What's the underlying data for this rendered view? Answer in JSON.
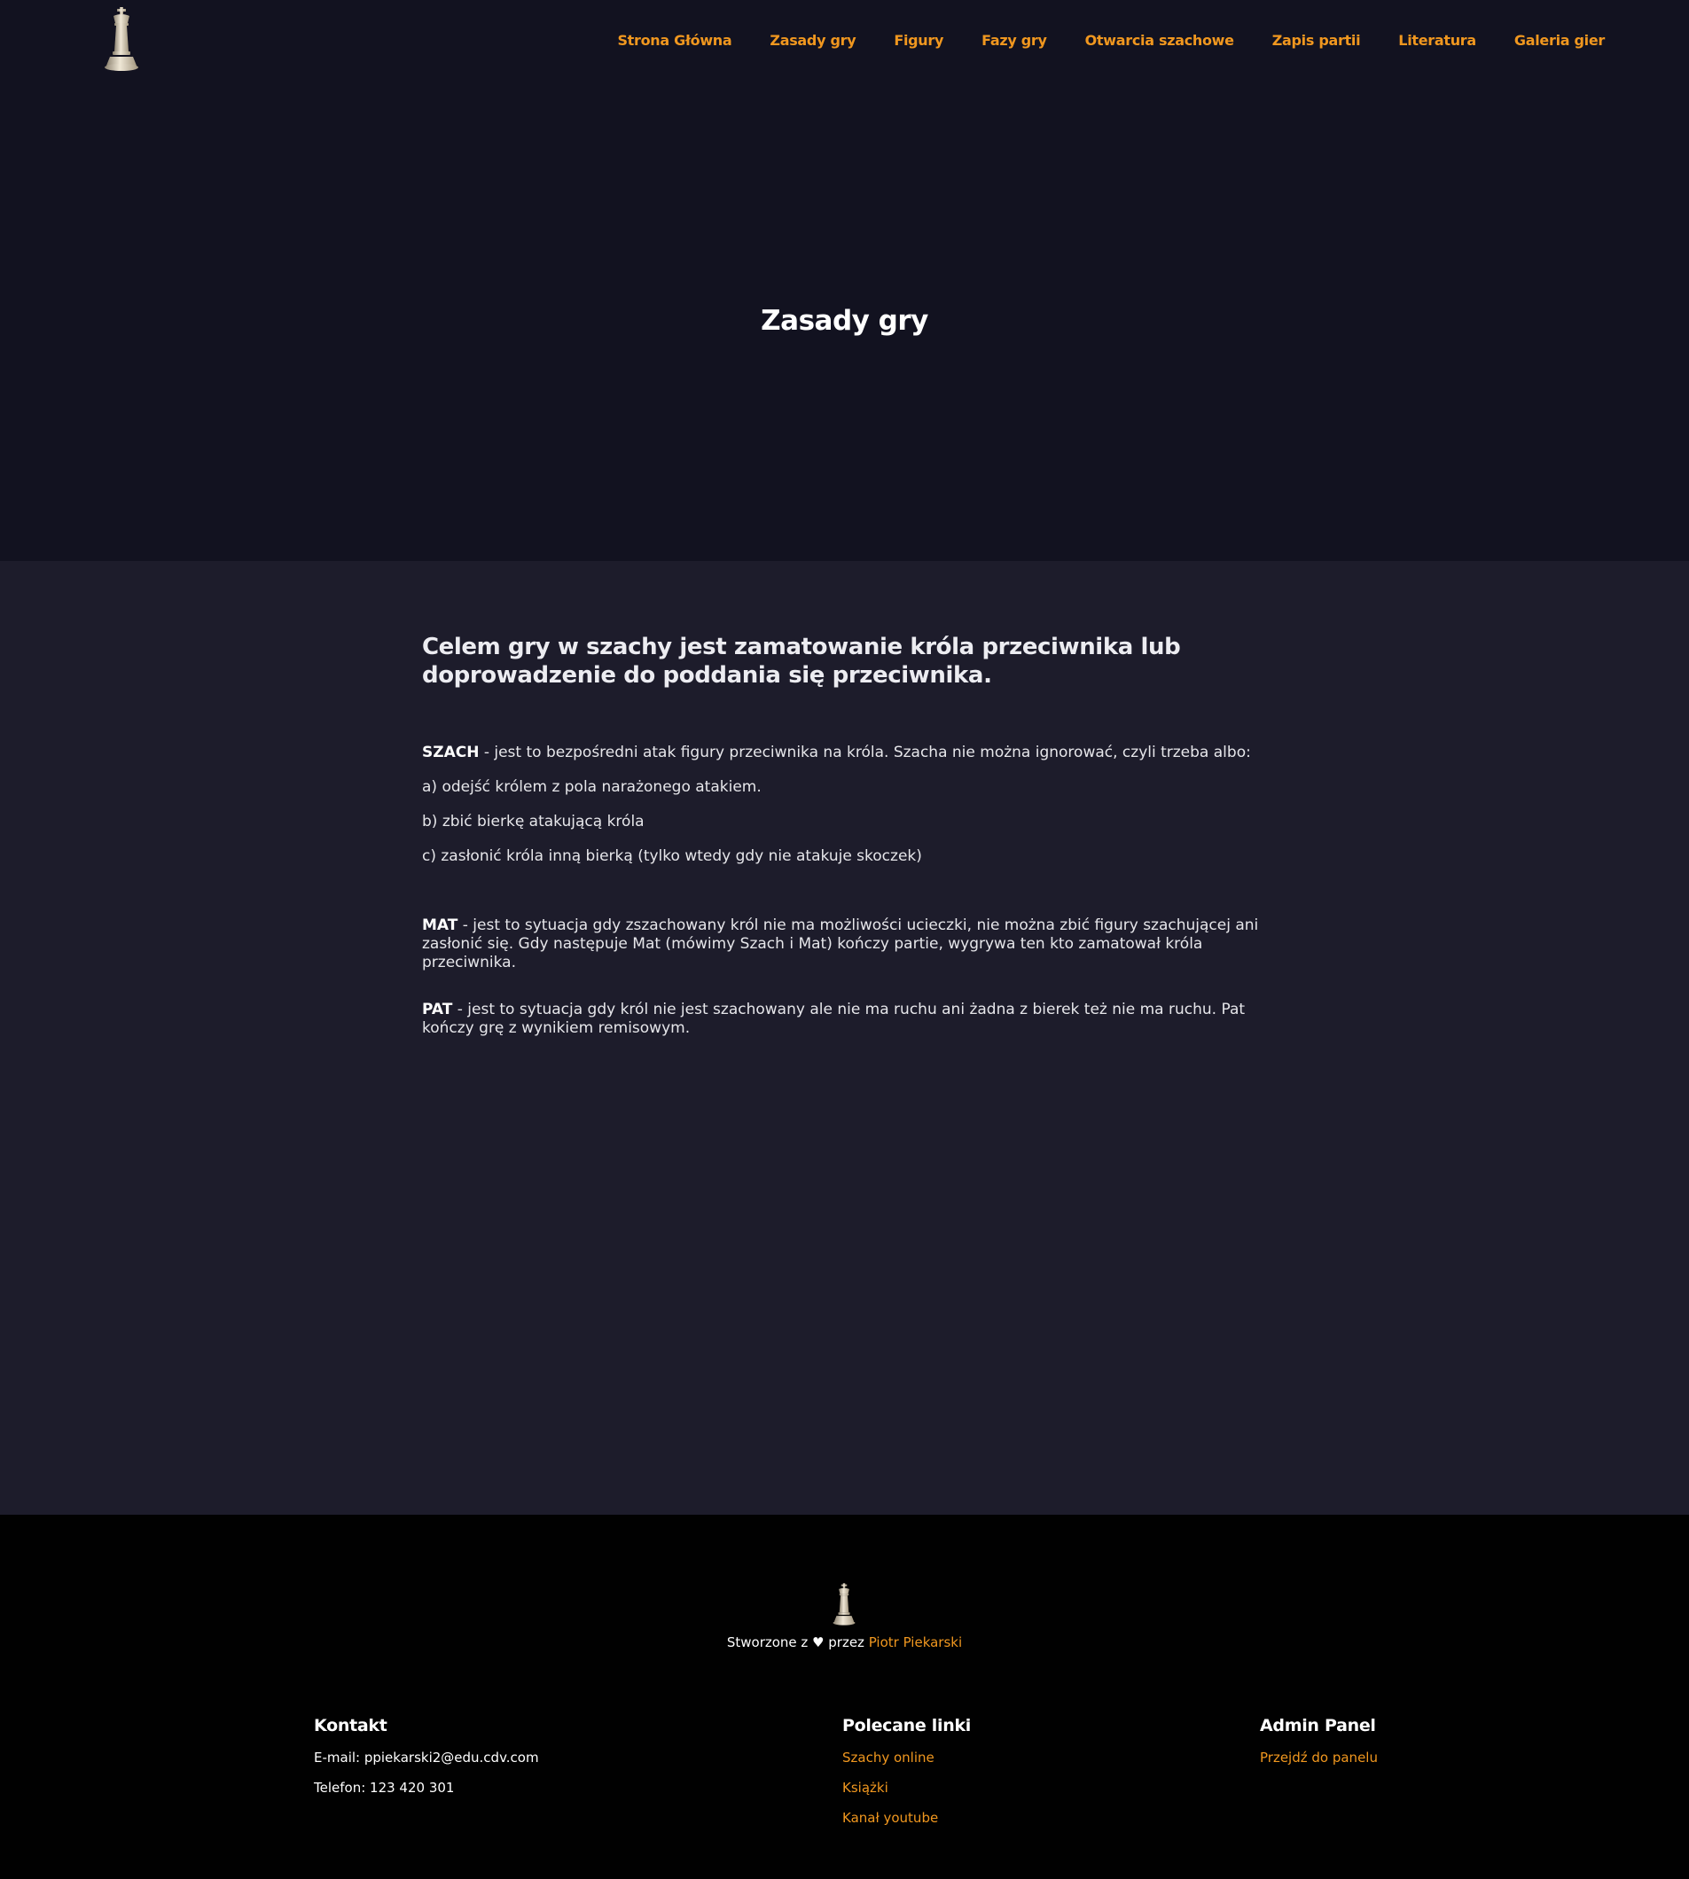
{
  "nav": {
    "items": [
      {
        "label": "Strona Główna"
      },
      {
        "label": "Zasady gry"
      },
      {
        "label": "Figury"
      },
      {
        "label": "Fazy gry"
      },
      {
        "label": "Otwarcia szachowe"
      },
      {
        "label": "Zapis partii"
      },
      {
        "label": "Literatura"
      },
      {
        "label": "Galeria gier"
      }
    ]
  },
  "hero": {
    "title": "Zasady gry"
  },
  "main": {
    "lead": "Celem gry w szachy jest zamatowanie króla przeciwnika lub doprowadzenie do poddania się przeciwnika.",
    "szach": {
      "term": "SZACH",
      "text": " - jest to bezpośredni atak figury przeciwnika na króla. Szacha nie można ignorować, czyli trzeba albo:",
      "options": [
        "a) odejść królem z pola narażonego atakiem.",
        "b) zbić bierkę atakującą króla",
        "c) zasłonić króla inną bierką (tylko wtedy gdy nie atakuje skoczek)"
      ]
    },
    "mat": {
      "term": "MAT",
      "text": " - jest to sytuacja gdy zszachowany król nie ma możliwości ucieczki, nie można zbić figury szachującej ani zasłonić się. Gdy następuje Mat (mówimy Szach i Mat) kończy partie, wygrywa ten kto zamatował króla przeciwnika."
    },
    "pat": {
      "term": "PAT",
      "text": " - jest to sytuacja gdy król nie jest szachowany ale nie ma ruchu ani żadna z bierek też nie ma ruchu. Pat kończy grę z wynikiem remisowym."
    }
  },
  "footer": {
    "credit_prefix": "Stworzone z ♥ przez ",
    "credit_author": "Piotr Piekarski",
    "kontakt": {
      "title": "Kontakt",
      "email": "E-mail: ppiekarski2@edu.cdv.com",
      "phone": "Telefon: 123 420 301"
    },
    "linki": {
      "title": "Polecane linki",
      "items": [
        "Szachy online",
        "Książki",
        "Kanał youtube"
      ]
    },
    "admin": {
      "title": "Admin Panel",
      "link": "Przejdź do panelu"
    }
  },
  "colors": {
    "accent": "#f0971f",
    "hero_bg": "#121220",
    "content_bg": "#1d1c2b",
    "footer_bg": "#010101"
  },
  "icons": {
    "logo": "chess-king-icon",
    "footer_logo": "chess-king-icon"
  }
}
